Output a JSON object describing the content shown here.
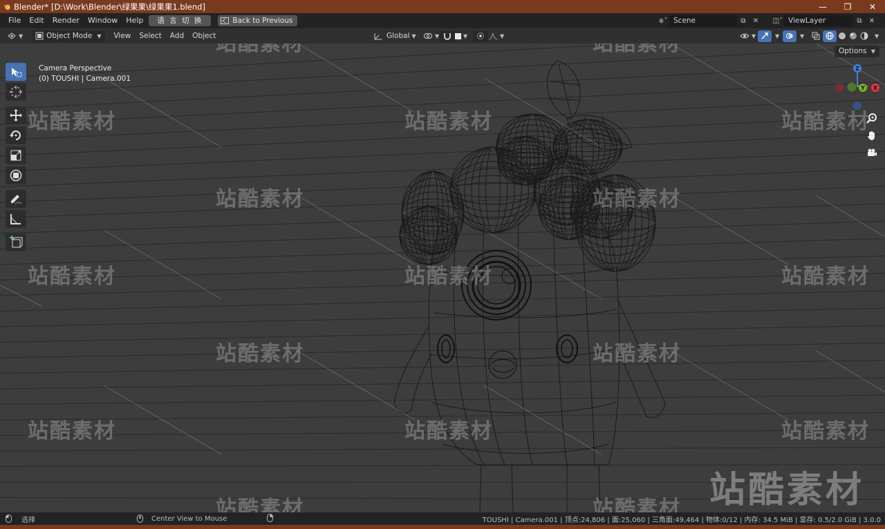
{
  "window": {
    "title": "Blender* [D:\\Work\\Blender\\绿果果\\绿果果1.blend]",
    "controls": [
      "minimize",
      "maximize",
      "close"
    ]
  },
  "topbar": {
    "menus": [
      "File",
      "Edit",
      "Render",
      "Window",
      "Help"
    ],
    "lang_button": "语 言 切 换",
    "back_button": "Back to Previous",
    "scene": "Scene",
    "view_layer": "ViewLayer"
  },
  "header": {
    "mode": "Object Mode",
    "menus": [
      "View",
      "Select",
      "Add",
      "Object"
    ],
    "transform_orientation": "Global",
    "options": "Options"
  },
  "viewport": {
    "camera_label": "Camera Perspective",
    "object_label": "(0) TOUSHI | Camera.001",
    "gizmo": {
      "z": "Z",
      "y": "Y",
      "x": "X"
    }
  },
  "watermark": {
    "text": "站酷素材",
    "big_text": "站酷素材"
  },
  "tools": [
    "select-box",
    "cursor",
    "move",
    "rotate",
    "scale",
    "transform",
    "annotate",
    "measure",
    "add-cube"
  ],
  "status": {
    "left_action": "选择",
    "mid_action": "Center View to Mouse",
    "stats": "TOUSHI | Camera.001 | 顶点:24,806 | 面:25,060 | 三角面:49,464 | 物体:0/12 | 内存: 34.5 MiB | 显存: 0.5/2.0 GiB | 3.0.0"
  },
  "colors": {
    "title_bar": "#7a3a1f",
    "active_tool": "#4772b3",
    "axis_x": "#e8333f",
    "axis_y": "#72b526",
    "axis_z": "#3f82dd"
  }
}
